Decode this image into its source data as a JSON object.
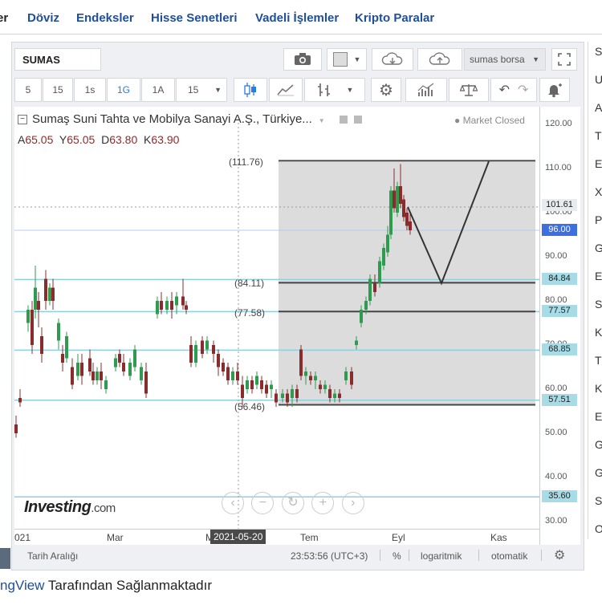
{
  "nav": {
    "items": [
      "er",
      "Döviz",
      "Endeksler",
      "Hisse Senetleri",
      "Vadeli İşlemler",
      "Kripto Paralar"
    ]
  },
  "toolbar": {
    "symbol": "SUMAS",
    "exchange": "sumas borsa",
    "intervals": [
      "5",
      "15",
      "1s",
      "1G",
      "1A",
      "15"
    ],
    "selected_interval": "1G"
  },
  "legend": {
    "title": "Sumaş Suni Tahta ve Mobilya Sanayi A.Ş., Türkiye...",
    "open_label": "A",
    "open": "65.05",
    "high_label": "Y",
    "high": "65.05",
    "low_label": "D",
    "low": "63.80",
    "close_label": "K",
    "close": "63.90",
    "status": "Market Closed"
  },
  "price_axis": {
    "ticks": [
      "120.00",
      "110.00",
      "100.00",
      "90.00",
      "80.00",
      "70.00",
      "60.00",
      "50.00",
      "40.00",
      "30.00"
    ],
    "tags": [
      {
        "value": "101.61",
        "color": "#e9ecef"
      },
      {
        "value": "96.00",
        "color": "#3d6fe0"
      },
      {
        "value": "84.84",
        "color": "#a7dbe6"
      },
      {
        "value": "77.57",
        "color": "#a7dbe6"
      },
      {
        "value": "68.85",
        "color": "#a7dbe6"
      },
      {
        "value": "57.51",
        "color": "#a7dbe6"
      },
      {
        "value": "35.60",
        "color": "#a7dbe6"
      }
    ]
  },
  "fib_labels": [
    "(111.76)",
    "(84.11)",
    "(77.58)",
    "(56.46)"
  ],
  "time_axis": {
    "labels": [
      "021",
      "Mar",
      "M",
      "2021-05-20",
      "Tem",
      "Eyl",
      "Kas"
    ]
  },
  "bottom": {
    "range": "Tarih Aralığı",
    "time": "23:53:56 (UTC+3)",
    "percent": "%",
    "log": "logaritmik",
    "auto": "otomatik"
  },
  "watermark": {
    "name": "Investing",
    "suffix": ".com"
  },
  "right_letters": [
    "Se",
    "U",
    "A",
    "T",
    "E",
    "X",
    "P",
    "G",
    "E",
    "S",
    "K",
    "T",
    "K",
    "E",
    "G",
    "G",
    "S",
    "O"
  ],
  "footer": {
    "brand": "ngView",
    "text": " Tarafından Sağlanmaktadır"
  }
}
